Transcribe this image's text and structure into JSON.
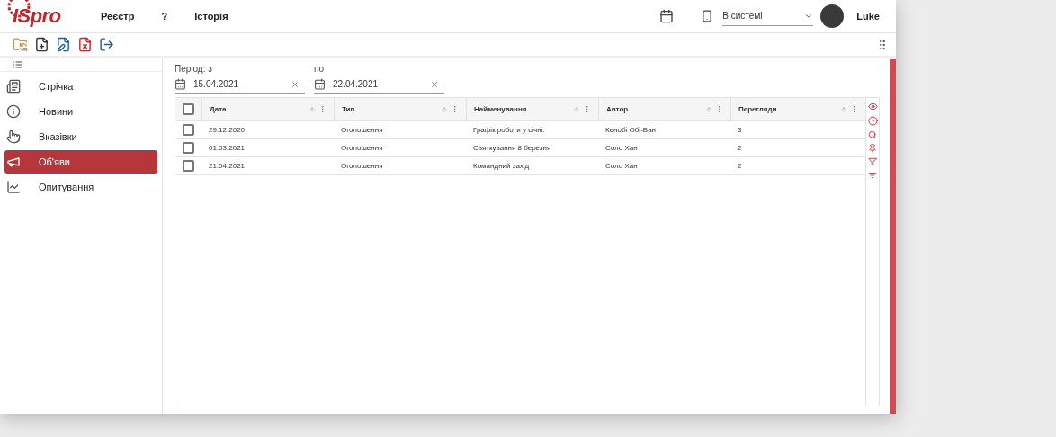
{
  "header": {
    "logo": "ISpro",
    "menu": [
      "Реєстр",
      "?",
      "Історія"
    ],
    "status_select": {
      "value": "В системі"
    },
    "user": "Luke"
  },
  "sidebar": {
    "items": [
      {
        "label": "Стрічка",
        "selected": false
      },
      {
        "label": "Новини",
        "selected": false
      },
      {
        "label": "Вказівки",
        "selected": false
      },
      {
        "label": "Об'яви",
        "selected": true
      },
      {
        "label": "Опитування",
        "selected": false
      }
    ]
  },
  "filter": {
    "from": {
      "label": "Період: з",
      "value": "15.04.2021"
    },
    "to": {
      "label": "по",
      "value": "22.04.2021"
    }
  },
  "table": {
    "columns": [
      "Дата",
      "Тип",
      "Найменування",
      "Автор",
      "Перегляди"
    ],
    "select_all_checked": false,
    "rows": [
      {
        "checked": false,
        "cells": [
          "29.12.2020",
          "Оголошення",
          "Графік роботи у січні.",
          "Кенобі Обі-Ван",
          "3"
        ]
      },
      {
        "checked": false,
        "cells": [
          "01.03.2021",
          "Оголошення",
          "Святкування 8 березня",
          "Соло Хан",
          "2"
        ]
      },
      {
        "checked": false,
        "cells": [
          "21.04.2021",
          "Оголошення",
          "Командний захід",
          "Соло Хан",
          "2"
        ]
      }
    ]
  }
}
